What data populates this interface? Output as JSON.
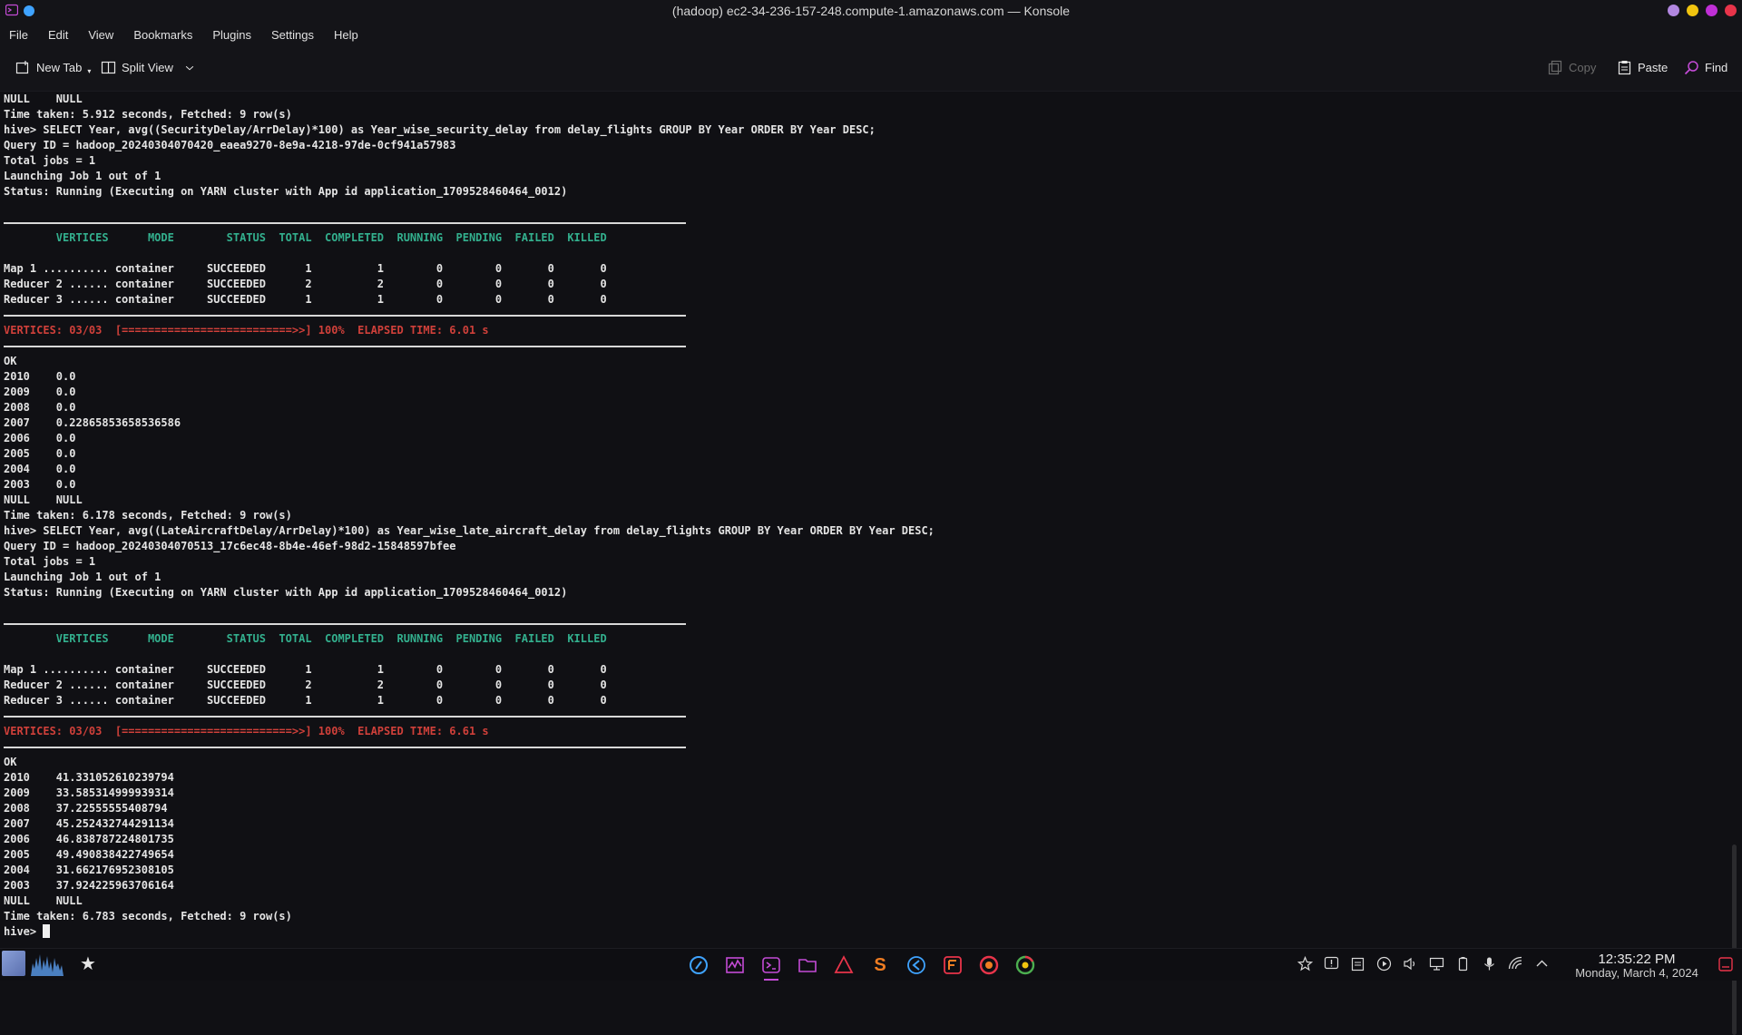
{
  "window": {
    "title": "(hadoop) ec2-34-236-157-248.compute-1.amazonaws.com — Konsole",
    "app_icon": "konsole-icon",
    "window_button_colors": [
      "#b287e0",
      "#f1c40f",
      "#c02fd6",
      "#e8344a"
    ]
  },
  "menu": [
    "File",
    "Edit",
    "View",
    "Bookmarks",
    "Plugins",
    "Settings",
    "Help"
  ],
  "toolbar": {
    "new_tab": "New Tab",
    "split_view": "Split View",
    "copy": "Copy",
    "paste": "Paste",
    "find": "Find"
  },
  "colors": {
    "terminal_bg": "#101014",
    "header_green": "#33b08e",
    "progress_red": "#d0403a",
    "accent_purple": "#c44bd6"
  },
  "terminal": {
    "q1": {
      "pre_lines": [
        "NULL    NULL",
        "Time taken: 5.912 seconds, Fetched: 9 row(s)"
      ],
      "command": "hive> SELECT Year, avg((SecurityDelay/ArrDelay)*100) as Year_wise_security_delay from delay_flights GROUP BY Year ORDER BY Year DESC;",
      "info": [
        "Query ID = hadoop_20240304070420_eaea9270-8e9a-4218-97de-0cf941a57983",
        "Total jobs = 1",
        "Launching Job 1 out of 1",
        "Status: Running (Executing on YARN cluster with App id application_1709528460464_0012)"
      ],
      "header": "        VERTICES      MODE        STATUS  TOTAL  COMPLETED  RUNNING  PENDING  FAILED  KILLED",
      "vertices": [
        "Map 1 .......... container     SUCCEEDED      1          1        0        0       0       0",
        "Reducer 2 ...... container     SUCCEEDED      2          2        0        0       0       0",
        "Reducer 3 ...... container     SUCCEEDED      1          1        0        0       0       0"
      ],
      "progress": "VERTICES: 03/03  [==========================>>] 100%  ELAPSED TIME: 6.01 s",
      "results": [
        "OK",
        "2010    0.0",
        "2009    0.0",
        "2008    0.0",
        "2007    0.22865853658536586",
        "2006    0.0",
        "2005    0.0",
        "2004    0.0",
        "2003    0.0",
        "NULL    NULL",
        "Time taken: 6.178 seconds, Fetched: 9 row(s)"
      ]
    },
    "q2": {
      "command": "hive> SELECT Year, avg((LateAircraftDelay/ArrDelay)*100) as Year_wise_late_aircraft_delay from delay_flights GROUP BY Year ORDER BY Year DESC;",
      "info": [
        "Query ID = hadoop_20240304070513_17c6ec48-8b4e-46ef-98d2-15848597bfee",
        "Total jobs = 1",
        "Launching Job 1 out of 1",
        "Status: Running (Executing on YARN cluster with App id application_1709528460464_0012)"
      ],
      "header": "        VERTICES      MODE        STATUS  TOTAL  COMPLETED  RUNNING  PENDING  FAILED  KILLED",
      "vertices": [
        "Map 1 .......... container     SUCCEEDED      1          1        0        0       0       0",
        "Reducer 2 ...... container     SUCCEEDED      2          2        0        0       0       0",
        "Reducer 3 ...... container     SUCCEEDED      1          1        0        0       0       0"
      ],
      "progress": "VERTICES: 03/03  [==========================>>] 100%  ELAPSED TIME: 6.61 s",
      "results": [
        "OK",
        "2010    41.331052610239794",
        "2009    33.585314999939314",
        "2008    37.22555555408794",
        "2007    45.252432744291134",
        "2006    46.838787224801735",
        "2005    49.490838422749654",
        "2004    31.662176952308105",
        "2003    37.924225963706164",
        "NULL    NULL",
        "Time taken: 6.783 seconds, Fetched: 9 row(s)"
      ]
    },
    "prompt": "hive> "
  },
  "taskbar": {
    "left_icons": [
      "app-launcher-icon",
      "system-monitor-graph-icon",
      "favorites-star-icon"
    ],
    "apps": [
      "discover-icon",
      "system-monitor-icon",
      "konsole-icon",
      "file-manager-icon",
      "warning-app-icon",
      "sublime-text-icon",
      "vscode-icon",
      "filezilla-icon",
      "firefox-icon",
      "chrome-icon"
    ],
    "active_app": "konsole-icon",
    "tray": [
      "star-icon",
      "notification-alert-icon",
      "clipboard-icon",
      "media-play-icon",
      "volume-icon",
      "display-icon",
      "battery-icon",
      "microphone-icon",
      "wifi-icon",
      "chevron-up-icon"
    ],
    "time": "12:35:22 PM",
    "date": "Monday, March 4, 2024"
  }
}
